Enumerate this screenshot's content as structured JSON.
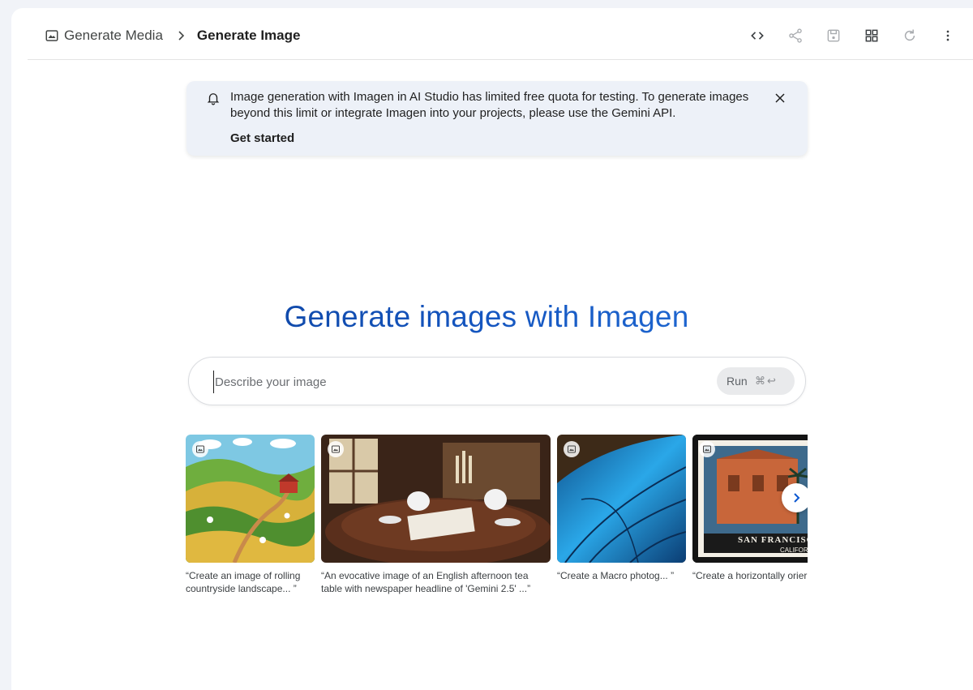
{
  "breadcrumb": {
    "parent": "Generate Media",
    "current": "Generate Image",
    "parent_icon": "image-frame-icon",
    "separator_icon": "chevron-right-icon"
  },
  "toolbar": {
    "icons": [
      "code-icon",
      "share-icon",
      "save-icon",
      "grid-icon",
      "refresh-icon",
      "more-vert-icon"
    ]
  },
  "banner": {
    "icon": "bell-icon",
    "message": "Image generation with Imagen in AI Studio has limited free quota for testing. To generate images beyond this limit or integrate Imagen into your projects, please use the Gemini API.",
    "action": "Get started",
    "close_icon": "close-icon"
  },
  "hero": {
    "title": "Generate images with Imagen"
  },
  "prompt": {
    "placeholder": "Describe your image",
    "run_label": "Run",
    "run_shortcut": "⌘↩"
  },
  "examples": [
    {
      "caption": "“Create an image of rolling countryside landscape... ”",
      "image": "countryside farm landscape"
    },
    {
      "caption": "“An evocative image of an English afternoon tea table with newspaper headline of 'Gemini 2.5' ...”",
      "image": "afternoon tea table"
    },
    {
      "caption": "“Create a Macro photog... ”",
      "image": "butterfly wing macro"
    },
    {
      "caption": "“Create a horizontally orier that features the Mission D",
      "image": "San Francisco stamp"
    }
  ],
  "stamp_text": {
    "city": "SAN FRANCISCO",
    "state": "CALIFORNIA"
  },
  "colors": {
    "accent": "#0b57d0",
    "banner_bg": "#edf1f8",
    "page_bg": "#f1f3f8"
  }
}
